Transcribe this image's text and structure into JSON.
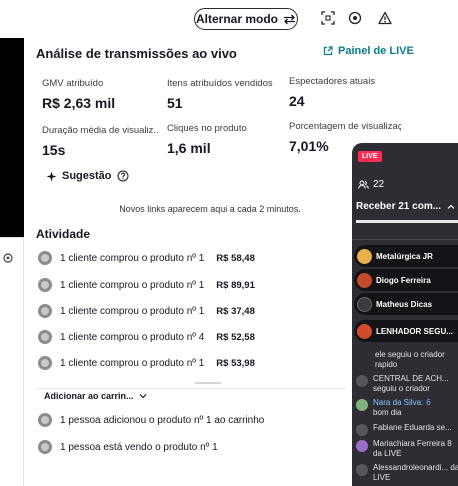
{
  "top_bar": {
    "mode_button_label": "Alternar modo",
    "icons": [
      "expand-icon",
      "record-icon",
      "warning-icon",
      "swap-icon"
    ]
  },
  "panel": {
    "title": "Análise de transmissões ao vivo",
    "live_dashboard_link": "Painel de LIVE"
  },
  "metrics": [
    {
      "label": "GMV atribuído",
      "value": "R$ 2,63 mil"
    },
    {
      "label": "Itens atribuídos vendidos",
      "value": "51"
    },
    {
      "label": "Espectadores atuais",
      "value": "24"
    },
    {
      "label": "Duração média de visualiz..",
      "value": "15s"
    },
    {
      "label": "Cliques no produto",
      "value": "1,6 mil"
    },
    {
      "label": "Porcentagem de visualizações",
      "value": "7,01%"
    }
  ],
  "suggestion": {
    "label": "Sugestão"
  },
  "hint": "Novos links aparecem aqui a cada 2 minutos.",
  "activity": {
    "title": "Atividade",
    "items": [
      {
        "text": "1 cliente comprou o produto nº 1",
        "price": "R$ 58,48"
      },
      {
        "text": "1 cliente comprou o produto nº 1",
        "price": "R$ 89,91"
      },
      {
        "text": "1 cliente comprou o produto nº 1",
        "price": "R$ 37,48"
      },
      {
        "text": "1 cliente comprou o produto nº 4",
        "price": "R$ 52,58"
      },
      {
        "text": "1 cliente comprou o produto nº 1",
        "price": "R$ 53,98"
      }
    ]
  },
  "cart": {
    "filter_label": "Adicionar ao carrin...",
    "items": [
      {
        "text": "1 pessoa adicionou o produto nº 1 ao carrinho"
      },
      {
        "text": "1 pessoa está vendo o produto nº 1"
      }
    ]
  },
  "live": {
    "badge": "LIVE",
    "viewers": "22",
    "receive_label": "Receber 21 com...",
    "gifts": [
      {
        "name": "Metalúrgica JR",
        "color": "#e8b04a"
      },
      {
        "name": "Diogo Ferreira",
        "color": "#c44a2a"
      },
      {
        "name": "Matheus Dicas",
        "color": "#3a3a3a"
      },
      {
        "name": "LENHADOR SEGU...",
        "color": "#d24b2a"
      }
    ],
    "chat": [
      {
        "name": "",
        "text": "ele seguiu o criador rapido"
      },
      {
        "name": "",
        "text": "CENTRAL DE ACH... seguiu o criador"
      },
      {
        "name": "Nara da Silva:",
        "level": "6",
        "text": "bom dia"
      },
      {
        "name": "",
        "text": "Fabiane Eduarda se..."
      },
      {
        "name": "",
        "text": "Mariachiara Ferreira 8 da LIVE"
      },
      {
        "name": "",
        "text": "Alessandroleonardi... da LIVE"
      }
    ]
  },
  "colors": {
    "accent": "#0a7c8c",
    "live_red": "#fe2c55",
    "live_bg": "#2d2d33"
  }
}
